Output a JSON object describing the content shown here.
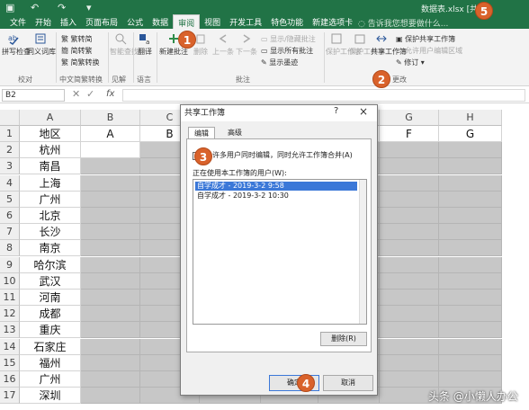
{
  "title_bar": {
    "filename": "数据表.xlsx [共享]",
    "menus": [
      "文件",
      "开始",
      "插入",
      "页面布局",
      "公式",
      "数据",
      "审阅",
      "视图",
      "开发工具",
      "特色功能",
      "新建选项卡"
    ],
    "active_menu": "审阅",
    "tell_me": "告诉我您想要做什么..."
  },
  "ribbon": {
    "proofing": {
      "spell": "拼写检查",
      "thesaurus": "同义词库",
      "label": "校对"
    },
    "chinese": {
      "to_simplified": "繁转简",
      "to_traditional": "简转繁",
      "convert": "简繁转换",
      "label": "中文简繁转换"
    },
    "insights": {
      "smart_lookup": "智能查找",
      "label": "见解"
    },
    "language": {
      "translate": "翻译",
      "label": "语言"
    },
    "comments": {
      "new": "新建批注",
      "delete": "删除",
      "prev": "上一条",
      "next": "下一条",
      "show_hide": "显示/隐藏批注",
      "show_all": "显示所有批注",
      "show_ink": "显示墨迹",
      "label": "批注"
    },
    "changes": {
      "protect_sheet": "保护工作表",
      "protect_workbook": "保护工作簿",
      "share_workbook": "共享工作簿",
      "protect_share": "保护共享工作簿",
      "allow_edit": "允许用户编辑区域",
      "track": "修订",
      "label": "更改"
    }
  },
  "formula_bar": {
    "name_box": "B2",
    "fx": "fx"
  },
  "grid": {
    "columns": [
      "A",
      "B",
      "C",
      "D",
      "E",
      "F",
      "G",
      "H"
    ],
    "rows": [
      "1",
      "2",
      "3",
      "4",
      "5",
      "6",
      "7",
      "8",
      "9",
      "10",
      "11",
      "12",
      "13",
      "14",
      "15",
      "16",
      "17"
    ],
    "header_row": {
      "A": "地区",
      "B": "A",
      "C": "B",
      "F": "E",
      "G": "F",
      "H": "G"
    },
    "cities": [
      "杭州",
      "南昌",
      "上海",
      "广州",
      "北京",
      "长沙",
      "南京",
      "哈尔滨",
      "武汉",
      "河南",
      "成都",
      "重庆",
      "石家庄",
      "福州",
      "广州",
      "深圳"
    ]
  },
  "dialog": {
    "title": "共享工作簿",
    "help": "?",
    "close": "×",
    "tabs": [
      "编辑",
      "高级"
    ],
    "checkbox_label": "允许多用户同时编辑，同时允许工作簿合并(A)",
    "checkbox_checked": false,
    "users_label": "正在使用本工作簿的用户(W):",
    "users": [
      "自学成才 - 2019-3-2 9:58",
      "自学成才 - 2019-3-2 10:30"
    ],
    "remove_button": "删除(R)",
    "ok_button": "确定",
    "cancel_button": "取消"
  },
  "steps": [
    "1",
    "2",
    "3",
    "4",
    "5"
  ],
  "watermark": "头条 @小懒人办公",
  "colors": {
    "excel_green": "#217346",
    "badge": "#d9622b",
    "selection": "#3b78d8"
  }
}
